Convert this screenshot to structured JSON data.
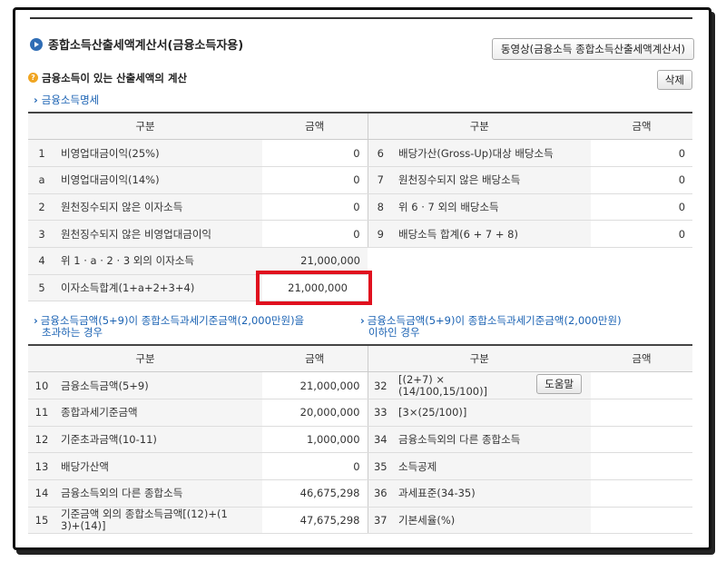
{
  "title": "종합소득산출세액계산서(금융소득자용)",
  "video_button": "동영상(금융소득 종합소득산출세액계산서)",
  "section_title": "금융소득이 있는 산출세액의 계산",
  "delete_button": "삭제",
  "detail_link": "금융소득명세",
  "help_button": "도움말",
  "table1": {
    "headers": [
      "구분",
      "금액",
      "구분",
      "금액"
    ],
    "left_rows": [
      {
        "no": "1",
        "label": "비영업대금이익(25%)",
        "amount": "0"
      },
      {
        "no": "a",
        "label": "비영업대금이익(14%)",
        "amount": "0"
      },
      {
        "no": "2",
        "label": "원천징수되지 않은 이자소득",
        "amount": "0"
      },
      {
        "no": "3",
        "label": "원천징수되지 않은 비영업대금이익",
        "amount": "0"
      },
      {
        "no": "4",
        "label": "위 1 · a · 2 · 3 외의 이자소득",
        "amount": "21,000,000"
      },
      {
        "no": "5",
        "label": "이자소득합계(1+a+2+3+4)",
        "amount": "21,000,000"
      }
    ],
    "right_rows": [
      {
        "no": "6",
        "label": "배당가산(Gross-Up)대상 배당소득",
        "amount": "0"
      },
      {
        "no": "7",
        "label": "원천징수되지 않은 배당소득",
        "amount": "0"
      },
      {
        "no": "8",
        "label": "위 6 · 7 외의 배당소득",
        "amount": "0"
      },
      {
        "no": "9",
        "label": "배당소득 합계(6 + 7 + 8)",
        "amount": "0"
      }
    ]
  },
  "cond_left": [
    "금융소득금액(5+9)이 종합소득과세기준금액(2,000만원)을",
    "초과하는 경우"
  ],
  "cond_right": [
    "금융소득금액(5+9)이 종합소득과세기준금액(2,000만원)",
    "이하인 경우"
  ],
  "table2": {
    "headers": [
      "구분",
      "금액",
      "구분",
      "금액"
    ],
    "left_rows": [
      {
        "no": "10",
        "label": "금융소득금액(5+9)",
        "amount": "21,000,000"
      },
      {
        "no": "11",
        "label": "종합과세기준금액",
        "amount": "20,000,000"
      },
      {
        "no": "12",
        "label": "기준초과금액(10-11)",
        "amount": "1,000,000"
      },
      {
        "no": "13",
        "label": "배당가산액",
        "amount": "0"
      },
      {
        "no": "14",
        "label": "금융소득외의 다른 종합소득",
        "amount": "46,675,298"
      },
      {
        "no": "15",
        "label_l1": "기준금액 외의 종합소득금액[(12)+(1",
        "label_l2": "3)+(14)]",
        "amount": "47,675,298"
      }
    ],
    "right_rows": [
      {
        "no": "32",
        "label_l1": "[(2+7) ×",
        "label_l2": "(14/100,15/100)]",
        "amount": ""
      },
      {
        "no": "33",
        "label": "[3×(25/100)]",
        "amount": ""
      },
      {
        "no": "34",
        "label": "금융소득외의 다른 종합소득",
        "amount": ""
      },
      {
        "no": "35",
        "label": "소득공제",
        "amount": ""
      },
      {
        "no": "36",
        "label": "과세표준(34-35)",
        "amount": ""
      },
      {
        "no": "37",
        "label": "기본세율(%)",
        "amount": ""
      }
    ]
  }
}
